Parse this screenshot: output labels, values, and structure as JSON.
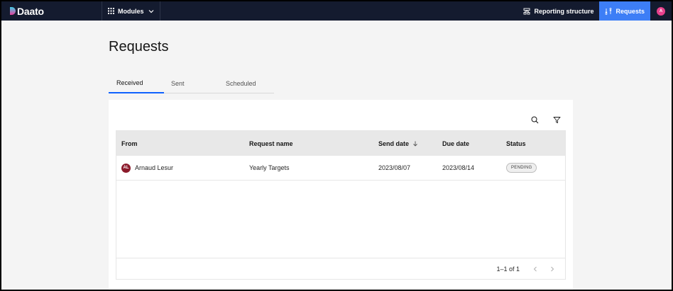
{
  "app": {
    "logo": "Daato"
  },
  "topbar": {
    "modules_label": "Modules",
    "reporting_label": "Reporting structure",
    "requests_label": "Requests",
    "user_initial": "A"
  },
  "page": {
    "title": "Requests"
  },
  "tabs": [
    {
      "label": "Received",
      "active": true
    },
    {
      "label": "Sent",
      "active": false
    },
    {
      "label": "Scheduled",
      "active": false
    }
  ],
  "table": {
    "headers": {
      "from": "From",
      "request_name": "Request name",
      "send_date": "Send date",
      "due_date": "Due date",
      "status": "Status"
    },
    "rows": [
      {
        "initials": "AL",
        "from": "Arnaud Lesur",
        "request_name": "Yearly Targets",
        "send_date": "2023/08/07",
        "due_date": "2023/08/14",
        "status": "PENDING"
      }
    ]
  },
  "pagination": {
    "range": "1–1 of 1"
  },
  "icons": {
    "search": "search-icon",
    "filter": "filter-icon",
    "sort": "arrow-down-icon",
    "prev": "chevron-left-icon",
    "next": "chevron-right-icon"
  },
  "colors": {
    "topbar": "#141b2f",
    "active_nav": "#3d7ef6",
    "tab_underline": "#0f62fe",
    "user_avatar": "#e8418c",
    "from_avatar": "#8b1a2b"
  }
}
